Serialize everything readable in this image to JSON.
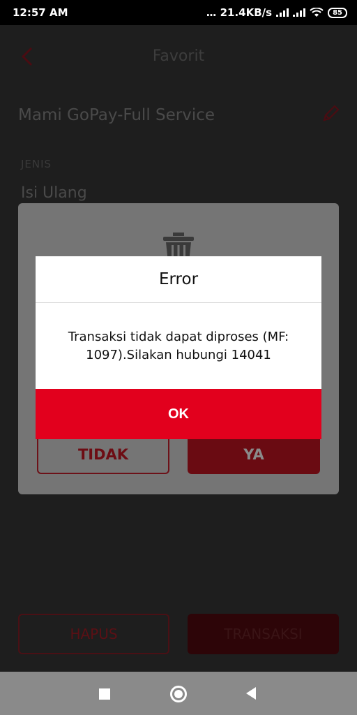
{
  "status_bar": {
    "time": "12:57 AM",
    "dots": "...",
    "speed": "21.4KB/s",
    "battery": "85"
  },
  "header": {
    "title": "Favorit"
  },
  "favorite": {
    "name": "Mami GoPay-Full Service",
    "type_label": "JENIS",
    "type_value": "Isi Ulang"
  },
  "bottom_actions": {
    "delete_label": "HAPUS",
    "transact_label": "TRANSAKSI"
  },
  "confirm_dialog": {
    "no_label": "TIDAK",
    "yes_label": "YA"
  },
  "error_dialog": {
    "title": "Error",
    "message": "Transaksi tidak dapat diproses (MF: 1097).Silakan hubungi 14041",
    "ok_label": "OK"
  },
  "colors": {
    "accent": "#e2001d",
    "overlay_dark": "#1e1e1e"
  }
}
